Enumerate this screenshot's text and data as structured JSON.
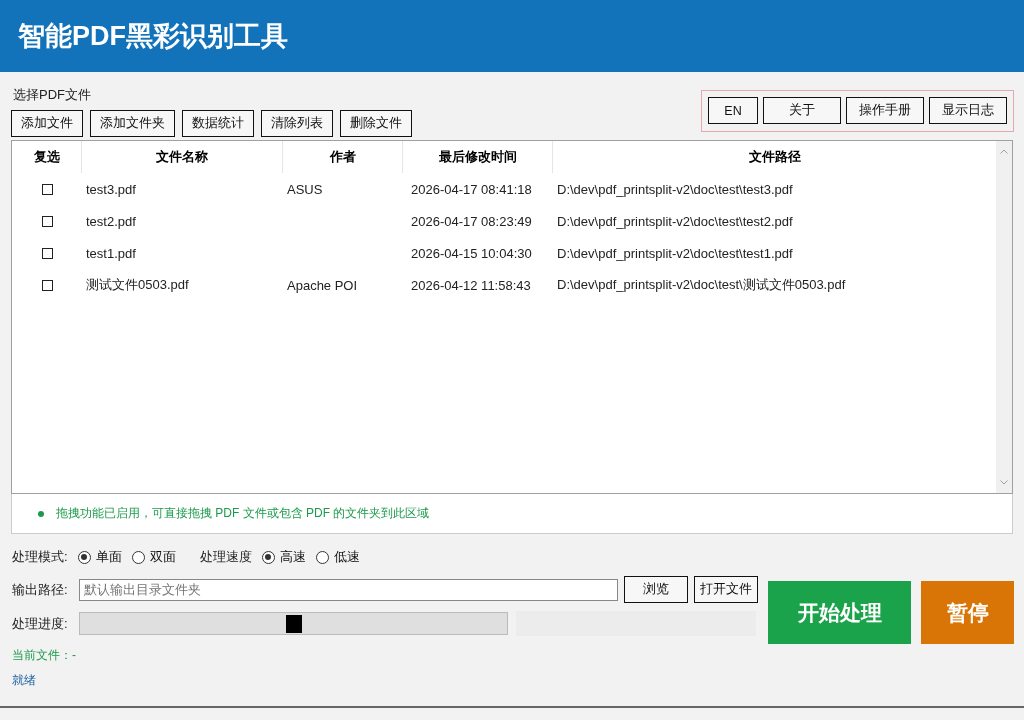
{
  "window": {
    "title": "智能PDF黑彩识别工具"
  },
  "section_label": "选择PDF文件",
  "toolbar": [
    "添加文件",
    "添加文件夹",
    "数据统计",
    "清除列表",
    "删除文件"
  ],
  "top_buttons": [
    "EN",
    "关于",
    "操作手册",
    "显示日志"
  ],
  "table": {
    "columns": [
      "复选",
      "文件名称",
      "作者",
      "最后修改时间",
      "文件路径"
    ],
    "rows": [
      {
        "checked": false,
        "name": "test3.pdf",
        "author": "ASUS",
        "modified": "2026-04-17 08:41:18",
        "path": "D:\\dev\\pdf_printsplit-v2\\doc\\test\\test3.pdf"
      },
      {
        "checked": false,
        "name": "test2.pdf",
        "author": "",
        "modified": "2026-04-17 08:23:49",
        "path": "D:\\dev\\pdf_printsplit-v2\\doc\\test\\test2.pdf"
      },
      {
        "checked": false,
        "name": "test1.pdf",
        "author": "",
        "modified": "2026-04-15 10:04:30",
        "path": "D:\\dev\\pdf_printsplit-v2\\doc\\test\\test1.pdf"
      },
      {
        "checked": false,
        "name": "测试文件0503.pdf",
        "author": "Apache POI",
        "modified": "2026-04-12 11:58:43",
        "path": "D:\\dev\\pdf_printsplit-v2\\doc\\test\\测试文件0503.pdf"
      }
    ]
  },
  "drop_hint": "拖拽功能已启用，可直接拖拽 PDF 文件或包含 PDF 的文件夹到此区域",
  "mode": {
    "label": "处理模式:",
    "options": [
      {
        "label": "单面",
        "selected": true
      },
      {
        "label": "双面",
        "selected": false
      }
    ]
  },
  "speed": {
    "label": "处理速度",
    "options": [
      {
        "label": "高速",
        "selected": true
      },
      {
        "label": "低速",
        "selected": false
      }
    ]
  },
  "output": {
    "label": "输出路径:",
    "placeholder": "默认输出目录文件夹",
    "buttons": [
      "浏览",
      "打开文件"
    ]
  },
  "progress": {
    "label": "处理进度:",
    "level": 0.5
  },
  "current_file": "当前文件：-",
  "status": "就绪",
  "actions": [
    {
      "label": "开始处理",
      "kind": "start"
    },
    {
      "label": "暂停",
      "kind": "pause"
    }
  ]
}
